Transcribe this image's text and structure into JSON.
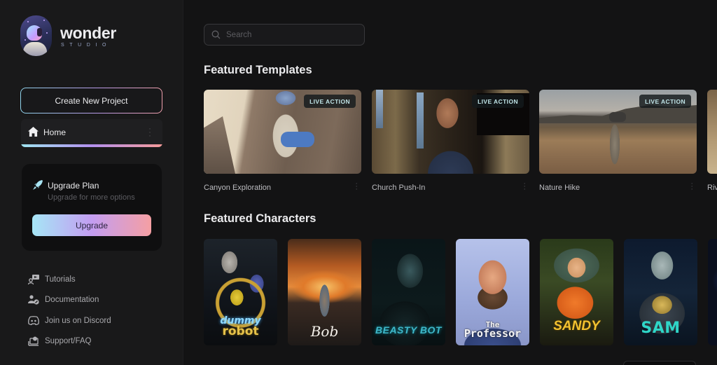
{
  "brand": {
    "name": "wonder",
    "subtitle": "STUDIO"
  },
  "sidebar": {
    "create_label": "Create New Project",
    "nav": [
      {
        "label": "Home",
        "icon": "home-icon",
        "active": true
      }
    ],
    "upgrade": {
      "title": "Upgrade Plan",
      "subtitle": "Upgrade for more options",
      "button_label": "Upgrade"
    },
    "links": [
      {
        "label": "Tutorials",
        "icon": "tutorial-icon"
      },
      {
        "label": "Documentation",
        "icon": "documentation-icon"
      },
      {
        "label": "Join us on Discord",
        "icon": "discord-icon"
      },
      {
        "label": "Support/FAQ",
        "icon": "support-icon"
      }
    ]
  },
  "search": {
    "placeholder": "Search",
    "value": ""
  },
  "featured_templates": {
    "title": "Featured Templates",
    "items": [
      {
        "name": "Canyon Exploration",
        "badge": "LIVE ACTION"
      },
      {
        "name": "Church Push-In",
        "badge": "LIVE ACTION"
      },
      {
        "name": "Nature Hike",
        "badge": "LIVE ACTION"
      },
      {
        "name": "Riv",
        "badge": ""
      }
    ]
  },
  "featured_characters": {
    "title": "Featured Characters",
    "items": [
      {
        "name": "dummy robot",
        "title_line1": "dummy",
        "title_line2": "robot"
      },
      {
        "name": "Bob",
        "title_line1": "Bob"
      },
      {
        "name": "Beasty Bot",
        "title_line1": "BEASTY BOT"
      },
      {
        "name": "The Professor",
        "title_line1": "The",
        "title_line2": "Professor"
      },
      {
        "name": "Sandy",
        "title_line1": "SANDY"
      },
      {
        "name": "Sam",
        "title_line1": "SAM"
      }
    ]
  },
  "colors": {
    "accent_gradient_start": "#a6e6f6",
    "accent_gradient_mid": "#c39df1",
    "accent_gradient_end": "#f59fa3",
    "background": "#131314",
    "sidebar": "#19191a"
  }
}
